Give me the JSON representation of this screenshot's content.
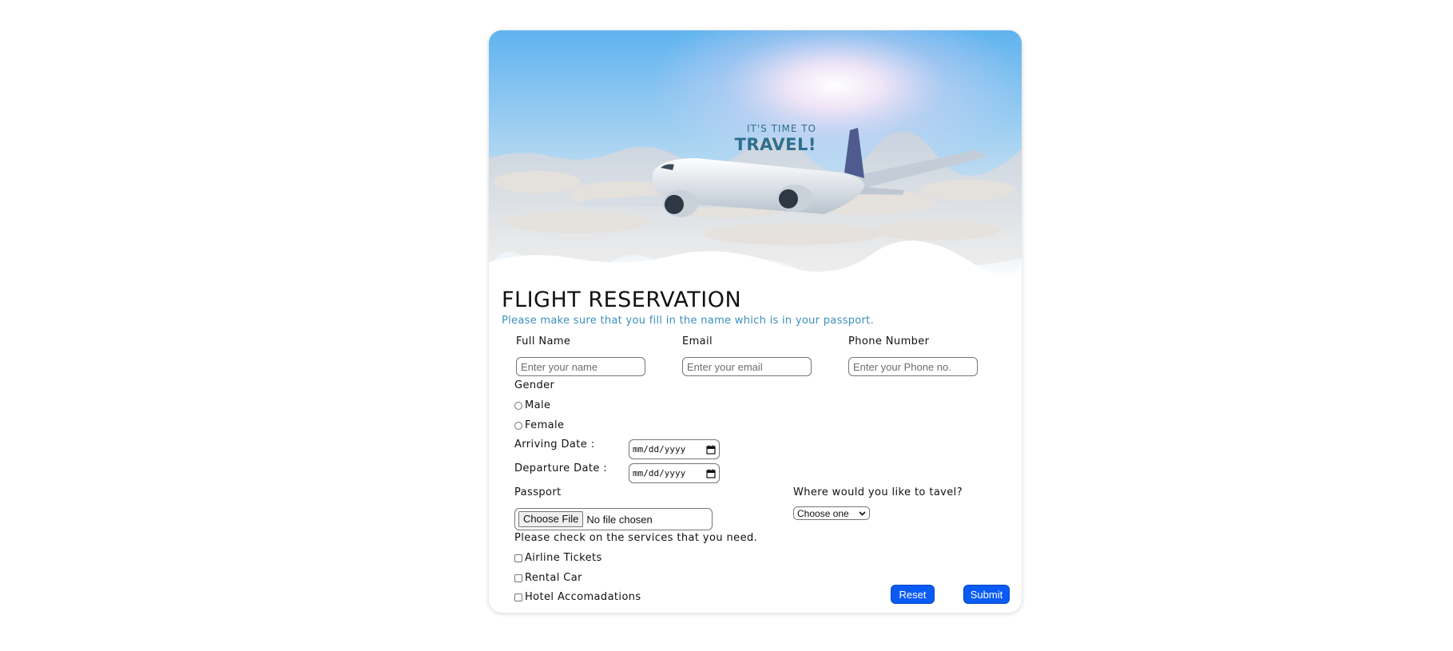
{
  "hero": {
    "tagline_small": "IT'S TIME TO",
    "tagline_big": "TRAVEL!"
  },
  "form": {
    "title": "FLIGHT RESERVATION",
    "subtitle": "Please make sure that you fill in the name which is in your passport.",
    "full_name": {
      "label": "Full Name",
      "placeholder": "Enter your name",
      "value": ""
    },
    "email": {
      "label": "Email",
      "placeholder": "Enter your email",
      "value": ""
    },
    "phone": {
      "label": "Phone Number",
      "placeholder": "Enter your Phone no.",
      "value": ""
    },
    "gender": {
      "label": "Gender",
      "options": [
        "Male",
        "Female"
      ]
    },
    "arriving": {
      "label": "Arriving Date :",
      "value": "mm/dd/yyyy"
    },
    "departure": {
      "label": "Departure Date :",
      "value": "mm/dd/yyyy"
    },
    "passport": {
      "label": "Passport",
      "button": "Choose File",
      "status": "No file chosen"
    },
    "destination": {
      "label": "Where would you like to tavel?",
      "selected": "Choose one"
    },
    "services": {
      "label": "Please check on the services that you need.",
      "options": [
        "Airline Tickets",
        "Rental Car",
        "Hotel Accomadations"
      ]
    },
    "reset_label": "Reset",
    "submit_label": "Submit"
  },
  "colors": {
    "accent": "#0a5bf4",
    "subtitle": "#3a8fbf",
    "tagline": "#2e6f8e",
    "sky_top": "#5fb3ef"
  },
  "icons": {
    "calendar": "calendar-icon",
    "select_arrow": "chevron-down-icon"
  }
}
